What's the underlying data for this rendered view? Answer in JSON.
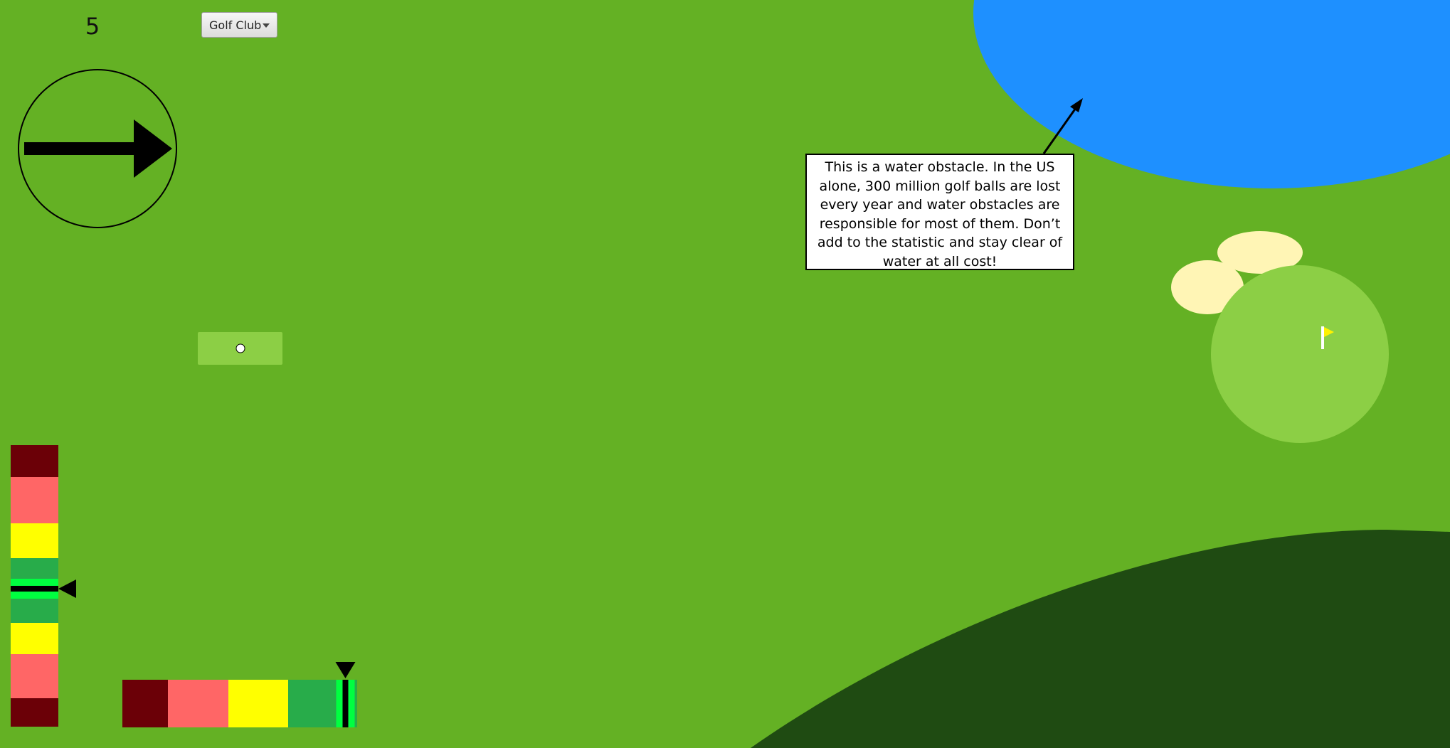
{
  "hud": {
    "stroke_count": "5",
    "club_selector": {
      "selected": "Golf Club",
      "caret_icon": "chevron-down-icon"
    },
    "aim_indicator": {
      "icon": "arrow-right-icon",
      "direction": "right"
    }
  },
  "course": {
    "water_color": "#1e90ff",
    "fairway_color": "#64b124",
    "green_color": "#8ccf45",
    "sand_color": "#fff5b5",
    "rough_color": "#1f4b12",
    "flag_color": "#fff200",
    "tooltip": {
      "text": "This is a water obstacle. In the US alone, 300 million golf balls are lost every year and water obstacles are responsible for most of them. Don’t add to the statistic and stay clear of water at all cost!"
    }
  },
  "meters": {
    "zone_colors": {
      "dark_red": "#6b0007",
      "light_red": "#ff6666",
      "yellow": "#ffff00",
      "green": "#28ac4a",
      "bright_green": "#00ff40"
    },
    "vertical_accuracy_level": 0.51,
    "horizontal_power_level": 0.95
  }
}
